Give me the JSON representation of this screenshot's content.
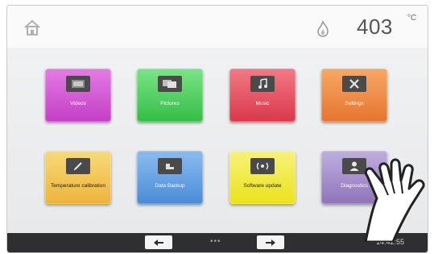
{
  "header": {
    "temperature": "403",
    "temperature_unit": "°C",
    "home_icon": "home-icon",
    "flame_icon": "flame-icon"
  },
  "tiles": [
    {
      "label": "Videos",
      "color": "#d255d4",
      "icon": "film-icon"
    },
    {
      "label": "Pictures",
      "color": "#49d15a",
      "icon": "images-icon"
    },
    {
      "label": "Music",
      "color": "#e84b5a",
      "icon": "music-icon"
    },
    {
      "label": "Settings",
      "color": "#ef8a3d",
      "icon": "tools-icon"
    },
    {
      "label": "Temperature calibration",
      "color": "#f2c24b",
      "icon": "pen-icon"
    },
    {
      "label": "Data Backup",
      "color": "#5c9be0",
      "icon": "backup-icon"
    },
    {
      "label": "Software update",
      "color": "#f1ea2e",
      "icon": "update-icon"
    },
    {
      "label": "Diagnostics",
      "color": "#a58ac9",
      "icon": "user-icon"
    }
  ],
  "footer": {
    "prev_icon": "arrow-left-icon",
    "next_icon": "arrow-right-icon",
    "page_dots": "•••",
    "clock": "14:42:55"
  },
  "colors": {
    "footer_bg": "#2d2f30",
    "header_bg": "#fafafa"
  }
}
